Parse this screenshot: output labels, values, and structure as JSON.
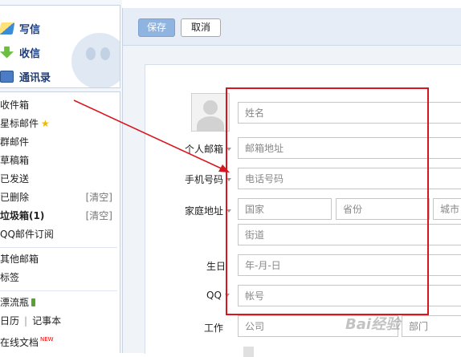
{
  "top_nav": {
    "write": "写信",
    "inbox": "收信",
    "contacts": "通讯录"
  },
  "folders": {
    "inbox": "收件箱",
    "starred": "星标邮件",
    "group": "群邮件",
    "drafts": "草稿箱",
    "sent": "已发送",
    "deleted": "已删除",
    "spam": "垃圾箱(1)",
    "qq_subscription": "QQ邮件订阅",
    "other_mailboxes": "其他邮箱",
    "tags": "标签",
    "drift_bottle": "漂流瓶",
    "calendar": "日历",
    "notepad": "记事本",
    "online_docs": "在线文档",
    "clear": "[清空]",
    "divider": "|",
    "new_badge": "NEW"
  },
  "toolbar": {
    "save": "保存",
    "cancel": "取消"
  },
  "form": {
    "name_placeholder": "姓名",
    "email_label": "个人邮箱",
    "email_placeholder": "邮箱地址",
    "phone_label": "手机号码",
    "phone_placeholder": "电话号码",
    "address_label": "家庭地址",
    "country_placeholder": "国家",
    "province_placeholder": "省份",
    "city_placeholder": "城市",
    "street_placeholder": "街道",
    "birthday_label": "生日",
    "birthday_placeholder": "年-月-日",
    "qq_label": "QQ",
    "qq_placeholder": "帐号",
    "work_label": "工作",
    "company_placeholder": "公司",
    "department_placeholder": "部门"
  },
  "watermark": "Bai经验",
  "colors": {
    "annotation_red": "#d8161f",
    "save_button": "#8fb4e0",
    "nav_text": "#1f3d78"
  }
}
